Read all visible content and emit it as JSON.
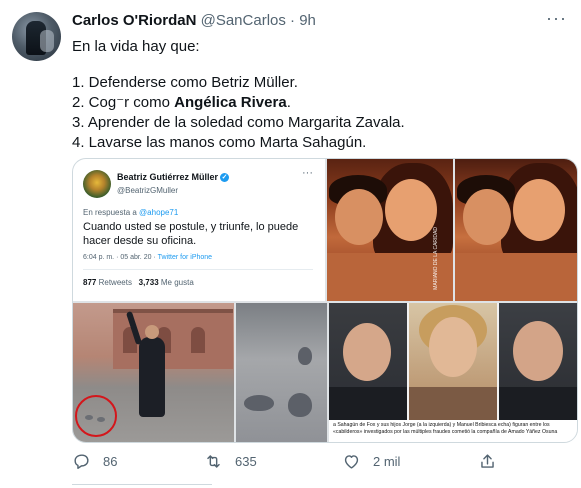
{
  "tweet": {
    "author_name": "Carlos O'RiordaN",
    "handle": "@SanCarlos",
    "separator": "·",
    "time": "9h",
    "more_icon": "more-dots-icon",
    "lines": {
      "intro": "En la vida hay que:",
      "l1": "1. Defenderse como Betriz Müller.",
      "l2_pre": "2. Cog⁻r como ",
      "l2_bold": "Angélica Rivera",
      "l2_post": ".",
      "l3": "3. Aprender de la soledad como Margarita Zavala.",
      "l4": "4. Lavarse las manos como Marta Sahagún."
    }
  },
  "embedded": {
    "name": "Beatriz Gutiérrez Müller",
    "verified_glyph": "✓",
    "handle": "@BeatrizGMuller",
    "more": "···",
    "reply_prefix": "En respuesta a ",
    "reply_mention": "@ahope71",
    "text": "Cuando usted se postule, y triunfe, lo puede hacer desde su oficina.",
    "meta_time": "6:04 p. m. · 05 abr. 20 · ",
    "meta_source": "Twitter for iPhone",
    "retweets_count": "877",
    "retweets_label": "Retweets",
    "likes_count": "3,733",
    "likes_label": "Me gusta"
  },
  "photos": {
    "watermark": "MARIANO DE LA CARIDAD",
    "caption": "a Sahagún de Fox y sus hijos Jorge (a la izquierda) y Manuel Bribiesca echa) figuran entre los «cabilderos» investigados por las múltiples fraudes cometió la compañía de Amado Yáñez Osuna"
  },
  "actions": {
    "reply_count": "86",
    "retweet_count": "635",
    "like_count": "2 mil",
    "icons": [
      "reply-icon",
      "retweet-icon",
      "like-icon",
      "share-icon"
    ]
  },
  "colors": {
    "accent": "#1d9bf0",
    "muted": "#536471",
    "text": "#0f1419",
    "circle": "#d4161b"
  }
}
